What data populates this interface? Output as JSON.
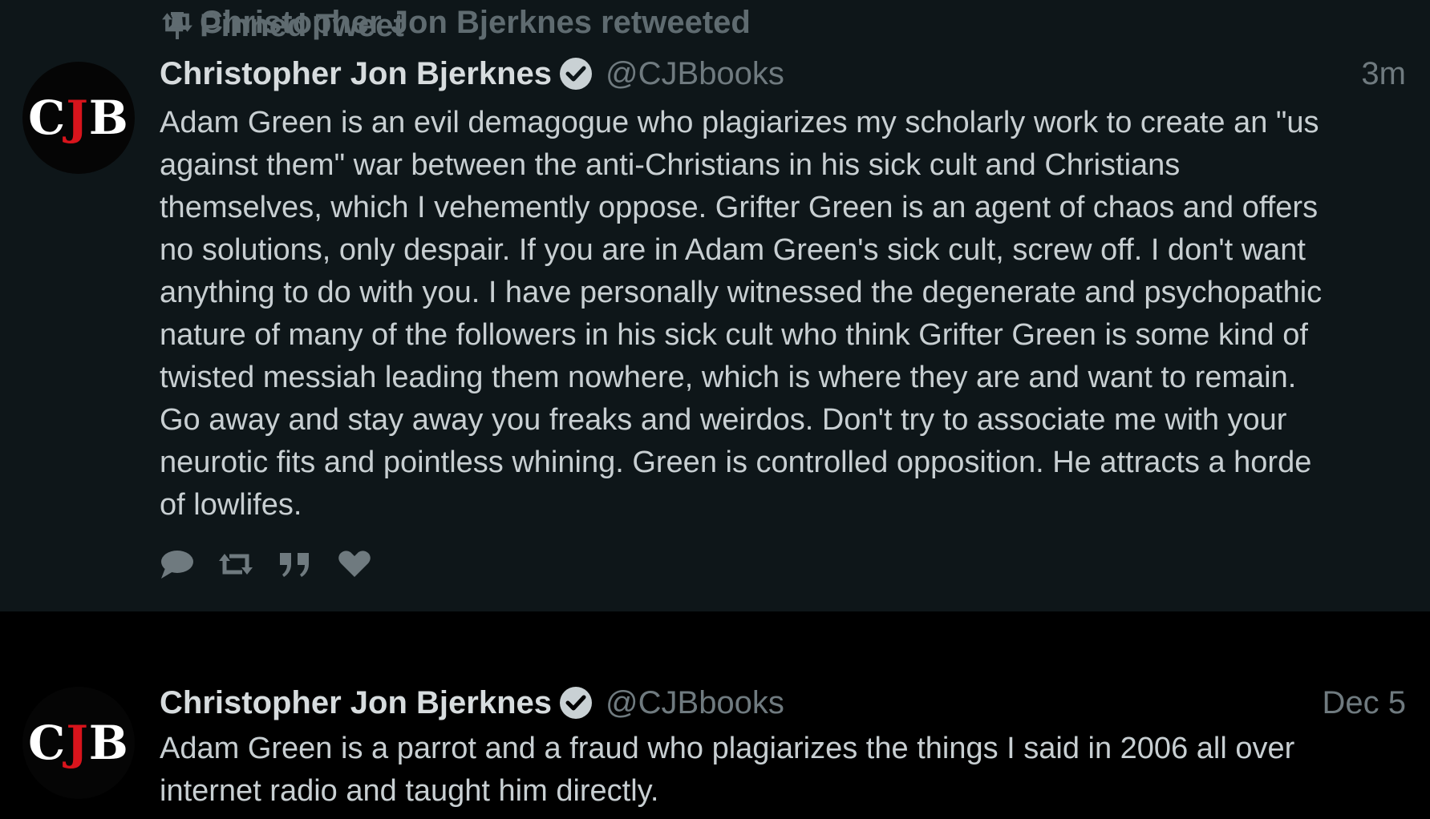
{
  "pinned_tweet": {
    "context_label": "Pinned Tweet",
    "context_icon": "pin-icon",
    "avatar_text": [
      "C",
      "J",
      "B"
    ],
    "display_name": "Christopher Jon Bjerknes",
    "handle": "@CJBbooks",
    "timestamp": "3m",
    "text_lines": [
      "Adam Green is an evil demagogue who plagiarizes my scholarly work to create an \"us",
      "against them\" war between the anti-Christians in his sick cult and Christians",
      "themselves, which I vehemently oppose. Grifter Green is an agent of chaos and offers",
      "no solutions, only despair. If you are in Adam Green's sick cult, screw off. I don't want",
      "anything to do with you. I have personally witnessed the degenerate and psychopathic",
      "nature of many of the followers in his sick cult who think Grifter Green is some kind of",
      "twisted messiah leading them nowhere, which is where they are and want to remain.",
      "Go away and stay away you freaks and weirdos. Don't try to associate me with your",
      "neurotic fits and pointless whining. Green is controlled opposition. He attracts a horde",
      "of lowlifes."
    ],
    "actions": [
      "reply-icon",
      "retweet-icon",
      "quote-icon",
      "like-icon"
    ]
  },
  "retweet": {
    "context_label": "Christopher Jon Bjerknes retweeted",
    "context_icon": "retweet-icon",
    "avatar_text": [
      "C",
      "J",
      "B"
    ],
    "display_name": "Christopher Jon Bjerknes",
    "handle": "@CJBbooks",
    "timestamp": "Dec 5",
    "text_lines": [
      "Adam Green is a parrot and a fraud who plagiarizes the things I said in 2006 all over",
      "internet radio and taught him directly."
    ]
  },
  "colors": {
    "pinned_background": "#0e1619",
    "feed_background": "#000000",
    "name_text": "#d7dcde",
    "body_text": "#c8cfd2",
    "muted_text": "#6f7a7f",
    "avatar_red": "#d8141c"
  }
}
